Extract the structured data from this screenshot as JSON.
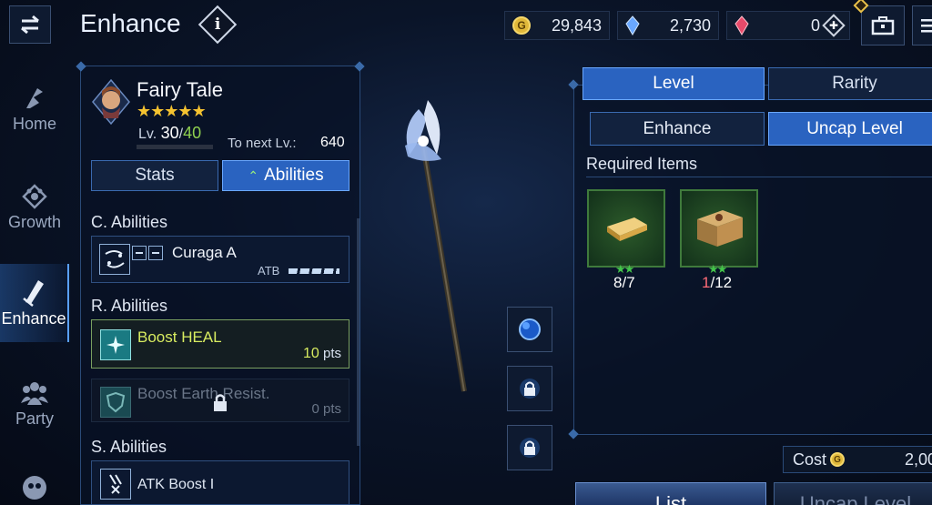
{
  "header": {
    "title": "Enhance",
    "info_icon": "info-icon",
    "back_icon": "back-arrow-icon"
  },
  "currency": {
    "gil": "29,843",
    "crystals": "2,730",
    "paid_crystals": "0"
  },
  "nav": [
    {
      "label": "Home",
      "icon": "home-icon"
    },
    {
      "label": "Growth",
      "icon": "growth-icon"
    },
    {
      "label": "Enhance",
      "icon": "enhance-icon",
      "active": true
    },
    {
      "label": "Party",
      "icon": "party-icon"
    },
    {
      "label": "",
      "icon": "more-icon"
    }
  ],
  "character": {
    "name": "Fairy Tale",
    "stars": "★★★★★",
    "level_label": "Lv.",
    "level": "30",
    "level_sep": "/",
    "level_max": "40",
    "next_label": "To next Lv.:",
    "next_value": "640"
  },
  "tabs": {
    "stats": "Stats",
    "abilities": "Abilities"
  },
  "abilities": {
    "c_header": "C. Abilities",
    "c_name": "Curaga A",
    "c_atb": "ATB",
    "r_header": "R. Abilities",
    "r1_name": "Boost HEAL",
    "r1_pts": "10",
    "r1_unit": "pts",
    "r2_name": "Boost Earth Resist.",
    "r2_pts": "0",
    "r2_unit": "pts",
    "s_header": "S. Abilities",
    "s_name": "ATK Boost I"
  },
  "right": {
    "tab_level": "Level",
    "tab_rarity": "Rarity",
    "tab_enhance": "Enhance",
    "tab_uncap": "Uncap Level",
    "required_label": "Required Items",
    "items": [
      {
        "icon": "gold-ingot-icon",
        "stars": "★★",
        "have": "8",
        "need": "/7"
      },
      {
        "icon": "supply-crate-icon",
        "stars": "★★",
        "have": "1",
        "need": "/12"
      }
    ],
    "cost_label": "Cost",
    "cost_value": "2,00",
    "btn_list": "List",
    "btn_uncap": "Uncap Level"
  },
  "colors": {
    "accent": "#2a63c0",
    "gold": "#f5c330",
    "green": "#8fd14f",
    "red": "#ff6b78"
  }
}
